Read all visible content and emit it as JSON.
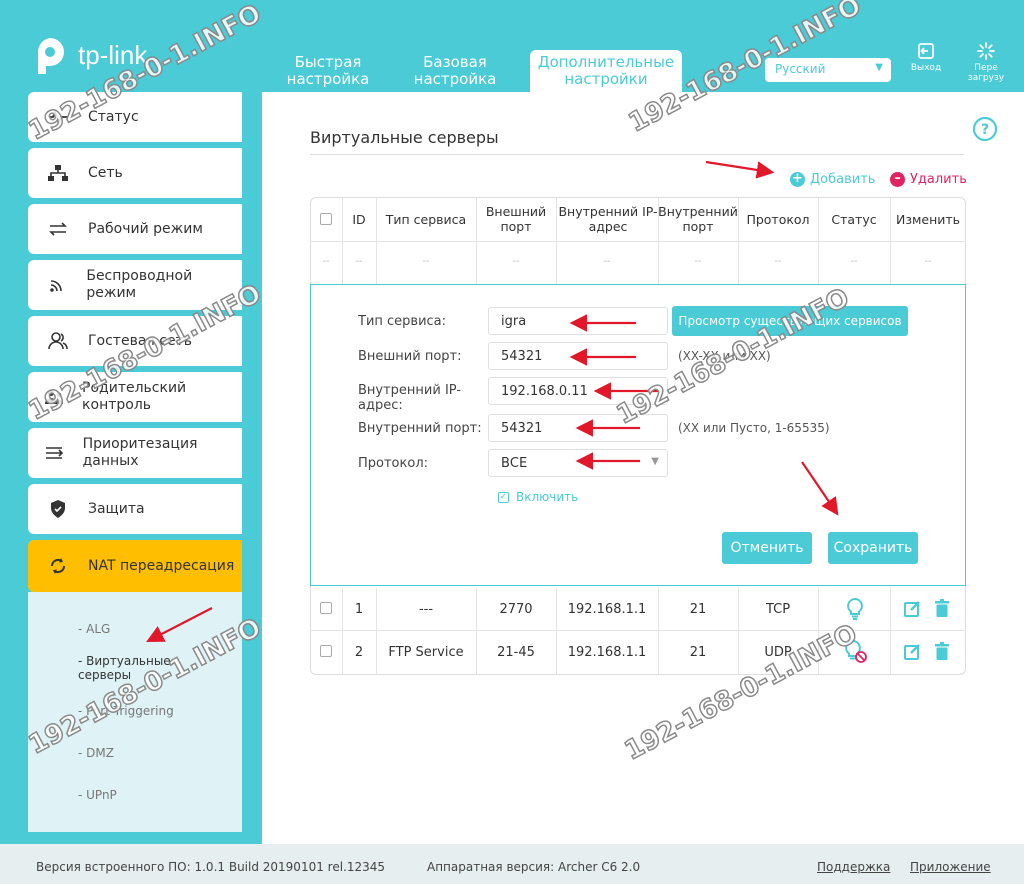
{
  "header": {
    "logo_text": "tp-link",
    "tabs": [
      {
        "label": "Быстрая настройка"
      },
      {
        "label": "Базовая настройка"
      },
      {
        "label": "Дополнительные настройки"
      }
    ],
    "language": "Русский",
    "exit_label": "Выход",
    "reboot_label": "Пере загрузу"
  },
  "sidebar": {
    "items": [
      {
        "label": "Статус",
        "icon": "pulse-icon"
      },
      {
        "label": "Сеть",
        "icon": "network-icon"
      },
      {
        "label": "Рабочий режим",
        "icon": "swap-icon"
      },
      {
        "label": "Беспроводной режим",
        "icon": "wifi-icon"
      },
      {
        "label": "Гостевая сеть",
        "icon": "guest-icon"
      },
      {
        "label": "Родительский контроль",
        "icon": "parental-icon"
      },
      {
        "label": "Приоритезация данных",
        "icon": "priority-icon"
      },
      {
        "label": "Защита",
        "icon": "shield-icon"
      },
      {
        "label": "NAT переадресация",
        "icon": "nat-icon"
      }
    ],
    "sub_items": [
      {
        "label": "- ALG"
      },
      {
        "label": "- Виртуальные серверы"
      },
      {
        "label": "- Port Triggering"
      },
      {
        "label": "- DMZ"
      },
      {
        "label": "- UPnP"
      }
    ]
  },
  "main": {
    "title": "Виртуальные серверы",
    "add_label": "Добавить",
    "delete_label": "Удалить",
    "table": {
      "headers": [
        "ID",
        "Тип сервиса",
        "Внешний порт",
        "Внутренний IP-адрес",
        "Внутренний порт",
        "Протокол",
        "Статус",
        "Изменить"
      ],
      "placeholder": "--",
      "rows": [
        {
          "id": "1",
          "service": "---",
          "ext_port": "2770",
          "ip": "192.168.1.1",
          "int_port": "21",
          "protocol": "TCP",
          "status": "enabled"
        },
        {
          "id": "2",
          "service": "FTP Service",
          "ext_port": "21-45",
          "ip": "192.168.1.1",
          "int_port": "21",
          "protocol": "UDP",
          "status": "disabled"
        }
      ]
    },
    "form": {
      "service_type_label": "Тип сервиса:",
      "service_type_value": "igra",
      "view_services_button": "Просмотр существующих сервисов",
      "ext_port_label": "Внешний порт:",
      "ext_port_value": "54321",
      "ext_port_hint": "(XX-XX или XX)",
      "int_ip_label": "Внутренний IP-адрес:",
      "int_ip_value": "192.168.0.11",
      "int_port_label": "Внутренний порт:",
      "int_port_value": "54321",
      "int_port_hint": "(XX или Пусто, 1-65535)",
      "protocol_label": "Протокол:",
      "protocol_value": "ВСЕ",
      "enable_label": "Включить",
      "cancel_button": "Отменить",
      "save_button": "Сохранить"
    }
  },
  "footer": {
    "firmware": "Версия встроенного ПО: 1.0.1 Build 20190101 rel.12345",
    "hardware": "Аппаратная версия: Archer C6 2.0",
    "support": "Поддержка",
    "app": "Приложение"
  },
  "watermark": "192-168-0-1.INFO",
  "colors": {
    "accent": "#4acbd6",
    "active_nav": "#ffbf00",
    "delete": "#e02462",
    "annotation_arrow": "#e0182a"
  }
}
